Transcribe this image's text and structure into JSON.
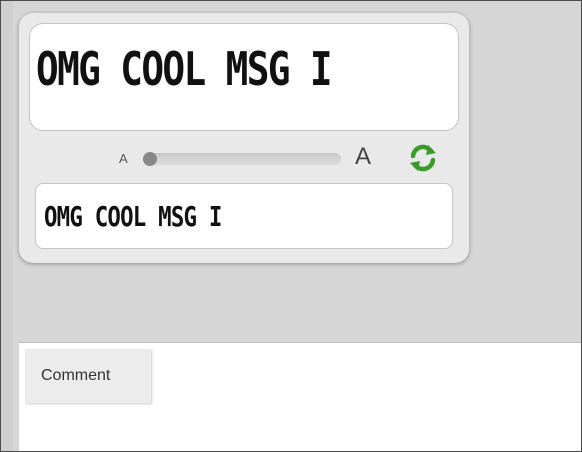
{
  "preview": {
    "text": "OMG COOL MSG I"
  },
  "size_control": {
    "small_label": "A",
    "large_label": "A",
    "slider_level": 0.0,
    "refresh_icon": "refresh-icon",
    "refresh_color": "#3a9a2a"
  },
  "message_input": {
    "value": "OMG COOL MSG I"
  },
  "comment_tab": {
    "label": "Comment"
  }
}
